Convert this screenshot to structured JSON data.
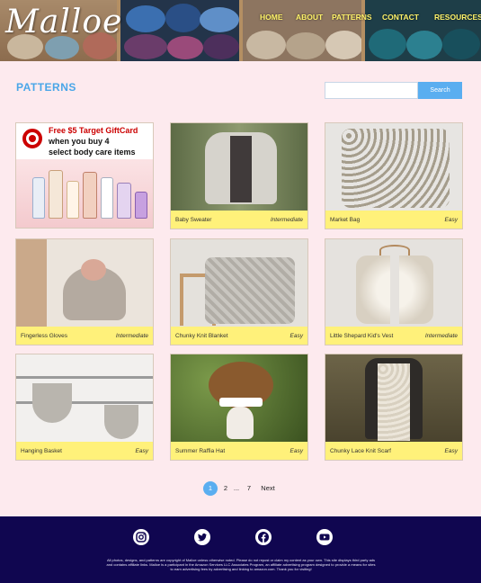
{
  "site": {
    "logo_text": "Malloe",
    "accent_yellow": "#fff36a",
    "accent_blue": "#4aa6e8",
    "footer_bg": "#100650"
  },
  "nav": {
    "items": [
      {
        "label": "HOME"
      },
      {
        "label": "ABOUT"
      },
      {
        "label": "PATTERNS"
      },
      {
        "label": "CONTACT"
      },
      {
        "label": "RESOURCES"
      }
    ]
  },
  "page": {
    "title": "PATTERNS"
  },
  "search": {
    "placeholder": "",
    "button_label": "Search"
  },
  "ad": {
    "line1": "Free $5 Target GiftCard",
    "line2": "when you buy 4",
    "line3": "select body care items"
  },
  "patterns": [
    {
      "name": "Baby Sweater",
      "level": "Intermediate",
      "icon": "sweater-photo"
    },
    {
      "name": "Market Bag",
      "level": "Easy",
      "icon": "bag-photo"
    },
    {
      "name": "Fingerless Gloves",
      "level": "Intermediate",
      "icon": "gloves-photo"
    },
    {
      "name": "Chunky Knit Blanket",
      "level": "Easy",
      "icon": "blanket-photo"
    },
    {
      "name": "Little Shepard Kid's Vest",
      "level": "Intermediate",
      "icon": "vest-photo"
    },
    {
      "name": "Hanging Basket",
      "level": "Easy",
      "icon": "basket-photo"
    },
    {
      "name": "Summer Raffia Hat",
      "level": "Easy",
      "icon": "hat-photo"
    },
    {
      "name": "Chunky Lace Knit Scarf",
      "level": "Easy",
      "icon": "scarf-photo"
    }
  ],
  "pagination": {
    "current": "1",
    "page2": "2",
    "ellipsis": "...",
    "last": "7",
    "next": "Next"
  },
  "footer": {
    "social": [
      "instagram-icon",
      "twitter-icon",
      "facebook-icon",
      "youtube-icon"
    ],
    "legal": "All photos, designs, and patterns are copyright of Malloe unless otherwise noted. Please do not repost or claim my content as your own. This site displays third party ads and contains affiliate links. Malloe is a participant in the Amazon Services LLC Associates Program, an affiliate advertising program designed to provide a means for sites to earn advertising fees by advertising and linking to amazon.com. Thank you for visiting!"
  }
}
